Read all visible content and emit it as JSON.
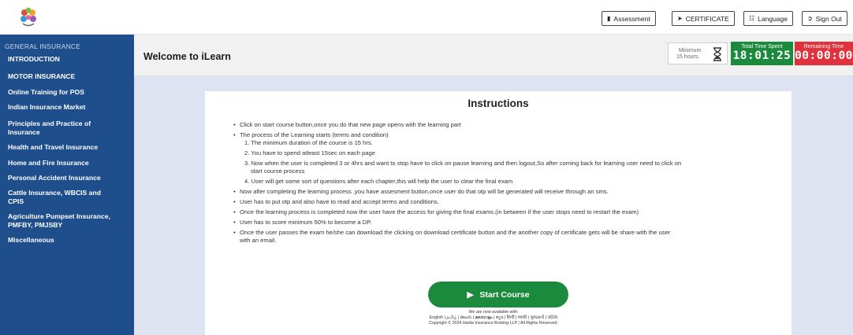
{
  "topbar": {
    "buttons": [
      {
        "label": "Assessment",
        "icon": "folder-icon"
      },
      {
        "label": "CERTIFICATE",
        "icon": "arrow-icon"
      },
      {
        "label": "Language",
        "icon": "translate-icon"
      },
      {
        "label": "Sign Out",
        "icon": "signout-icon"
      }
    ]
  },
  "sidebar": {
    "heading": "GENERAL INSURANCE",
    "items": [
      "INTRODUCTION",
      "MOTOR INSURANCE",
      "Online Training for POS",
      "Indian Insurance Market",
      "Principles and Practice of Insurance",
      "Health and Travel Insurance",
      "Home and Fire Insurance",
      "Personal Accident Insurance",
      "Cattle Insurance, WBCIS and CPIS",
      "Agriculture Pumpset Insurance, PMFBY, PMJSBY",
      "Miscellaneous"
    ]
  },
  "header": {
    "welcome": "Welcome to iLearn",
    "minimum_line1": "Minimum",
    "minimum_line2": "15 hours.",
    "total_label": "Total Time Spent",
    "total_value": "18:01:25",
    "remaining_label": "Remaining Time",
    "remaining_value": "00:00:00",
    "colors": {
      "total": "#1b8a3c",
      "remaining": "#e0323c"
    }
  },
  "instructions": {
    "title": "Instructions",
    "b1": "Click on start course button,once you do that new page opens with the learning part",
    "b2": "The process of the Learning starts (terms and condition)",
    "n1": "1. The minimum duration of the course is 15 hrs.",
    "n2": "2. You have to spend atleast 15sec on each page",
    "n3": "3. Now when the user is completed 3 or 4hrs and want to stop have to click on pause learning and then logout,So after coming back for learning user need to click on",
    "n3b": "start course process",
    "n4": "4. User will get some sort of questions after each chapter,this will help the user to clear the final exam",
    "b3": "Now after completing the learning process ,you have assesment button,once user do that otp will be generated will receive through an sms.",
    "b4": "User has to put otp and also have to read and accept terms and conditions.",
    "b5": "Once the learning process is completed now the user have the access for giving the final exams.(in between if the user stops need to restart the exam)",
    "b6": "User has to score minimum 50% to become a DP.",
    "b7": "Once the user passes the exam he/she can download the clicking on download certificate button and the another copy of certificate gets will be share with the user",
    "b7b": "with an email.",
    "start_label": "Start Course"
  },
  "footer": {
    "line1": "We are now available with:",
    "line2": "English | தமிழ் | తెలుగు | മലയാളം | ಕನ್ನಡ | हिन्दी | मराठी | ગુજરાતી | ଓଡ଼ିଆ",
    "line3": "Copyright © 2024 Harita Insurance Broking LLP | All Rights Reserved."
  }
}
